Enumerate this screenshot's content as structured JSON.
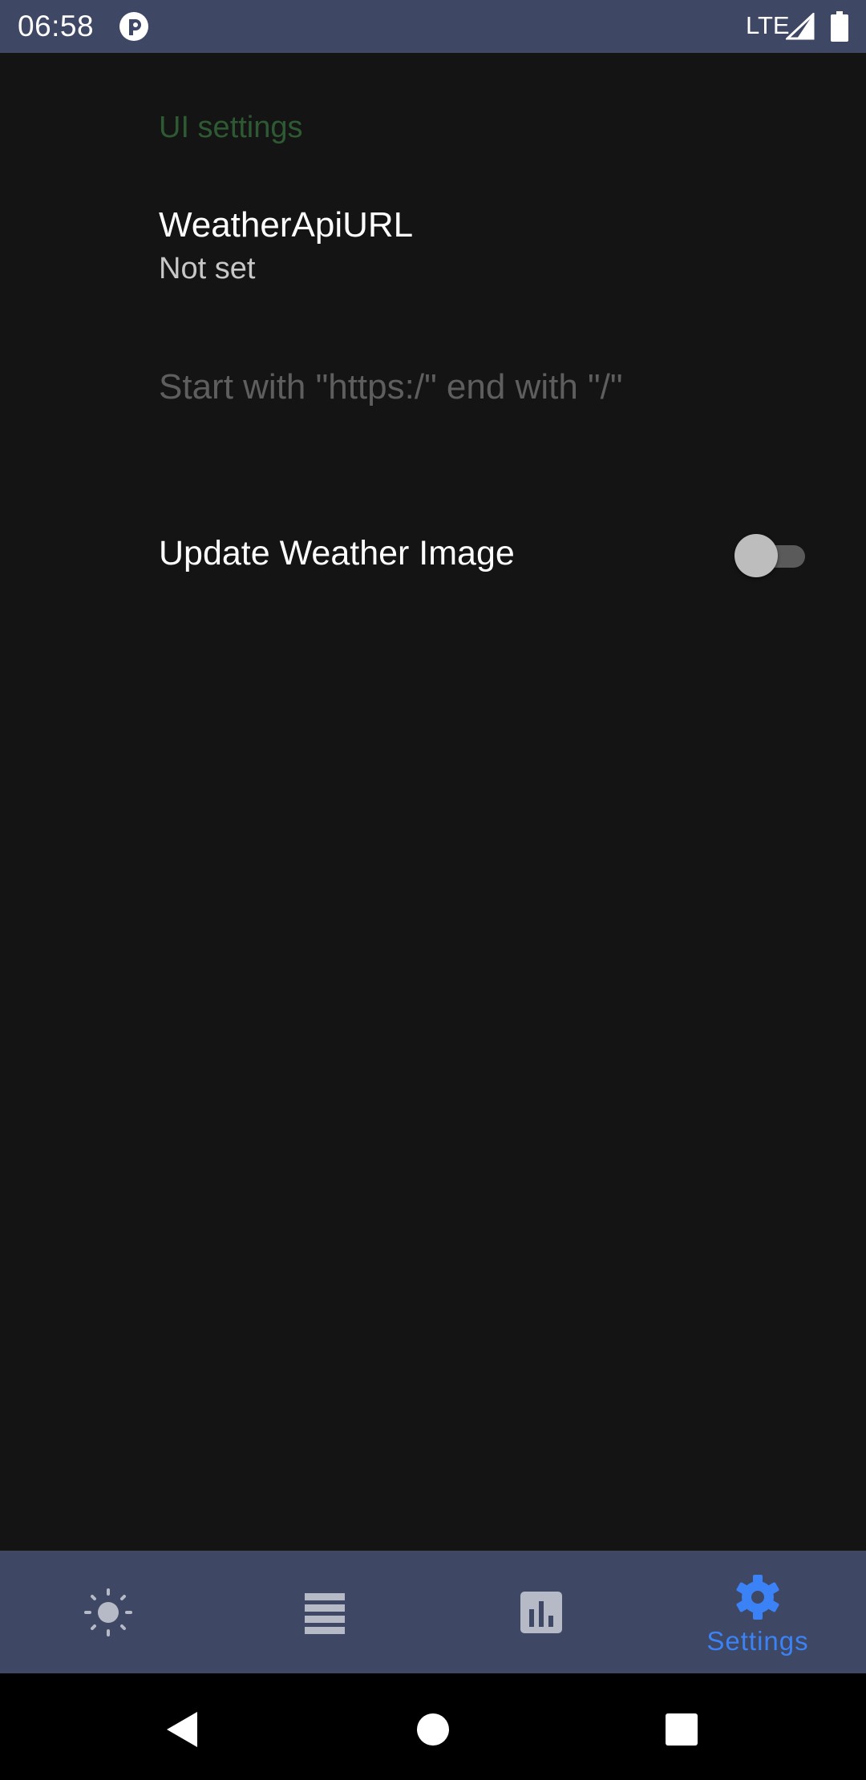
{
  "status_bar": {
    "time": "06:58",
    "network": "LTE",
    "icons": [
      "app-notification-icon",
      "signal-icon",
      "battery-icon"
    ]
  },
  "settings": {
    "section_title": "UI settings",
    "weather_api_url": {
      "title": "WeatherApiURL",
      "summary": "Not set"
    },
    "url_hint": "Start with \"https:/\" end with \"/\"",
    "update_weather_image": {
      "label": "Update Weather Image",
      "enabled": false
    }
  },
  "bottom_nav": {
    "items": [
      {
        "icon": "sun-icon",
        "label": ""
      },
      {
        "icon": "list-icon",
        "label": ""
      },
      {
        "icon": "chart-icon",
        "label": ""
      },
      {
        "icon": "gear-icon",
        "label": "Settings",
        "active": true
      }
    ],
    "active_color": "#3b82f6",
    "inactive_color": "#b6bac6"
  },
  "system_nav": {
    "buttons": [
      "back-icon",
      "home-icon",
      "recents-icon"
    ]
  },
  "colors": {
    "bar_background": "#3e4763",
    "content_background": "#141414",
    "section_title": "#2e5a33"
  }
}
